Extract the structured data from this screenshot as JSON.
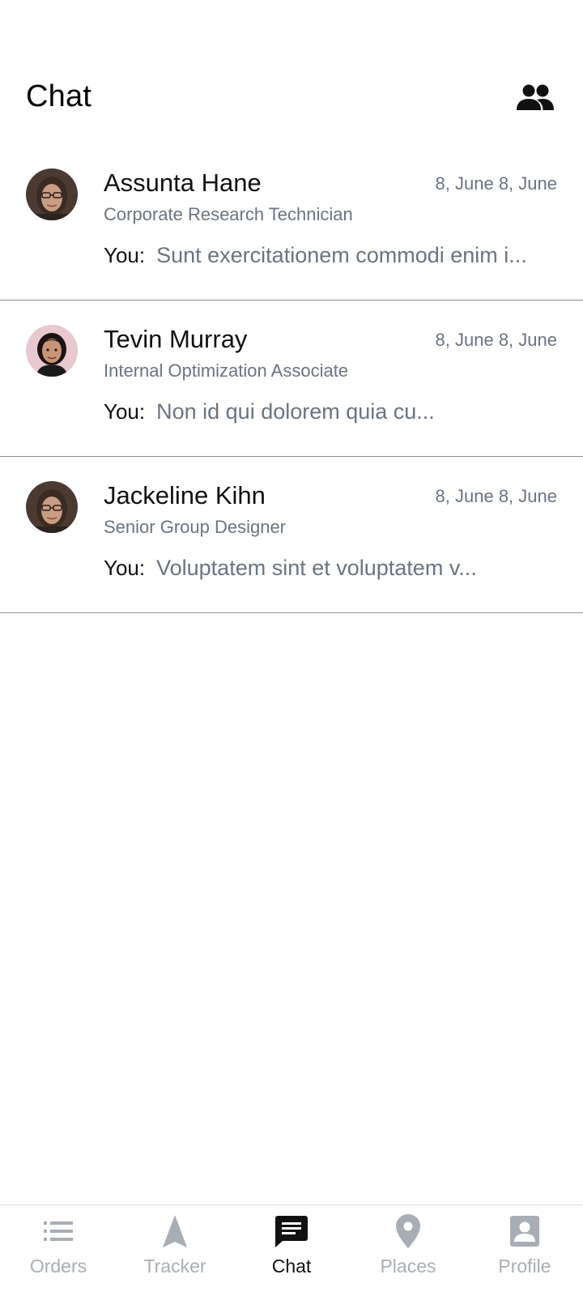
{
  "header": {
    "title": "Chat",
    "action_icon": "people-icon"
  },
  "chats": [
    {
      "name": "Assunta Hane",
      "role": "Corporate Research Technician",
      "date": "8, June 8, June",
      "sender": "You:",
      "preview": "Sunt exercitationem commodi enim i..."
    },
    {
      "name": "Tevin Murray",
      "role": "Internal Optimization Associate",
      "date": "8, June 8, June",
      "sender": "You:",
      "preview": "Non id qui dolorem quia cu..."
    },
    {
      "name": "Jackeline Kihn",
      "role": "Senior Group Designer",
      "date": "8, June 8, June",
      "sender": "You:",
      "preview": "Voluptatem sint et voluptatem v..."
    }
  ],
  "nav": {
    "items": [
      {
        "label": "Orders",
        "icon": "list-icon",
        "active": false
      },
      {
        "label": "Tracker",
        "icon": "navigation-arrow-icon",
        "active": false
      },
      {
        "label": "Chat",
        "icon": "chat-bubble-icon",
        "active": true
      },
      {
        "label": "Places",
        "icon": "location-pin-icon",
        "active": false
      },
      {
        "label": "Profile",
        "icon": "contact-card-icon",
        "active": false
      }
    ]
  },
  "colors": {
    "active": "#111111",
    "inactive": "#a9aeb5",
    "secondary_text": "#6b7480",
    "divider": "#8a8f96"
  }
}
